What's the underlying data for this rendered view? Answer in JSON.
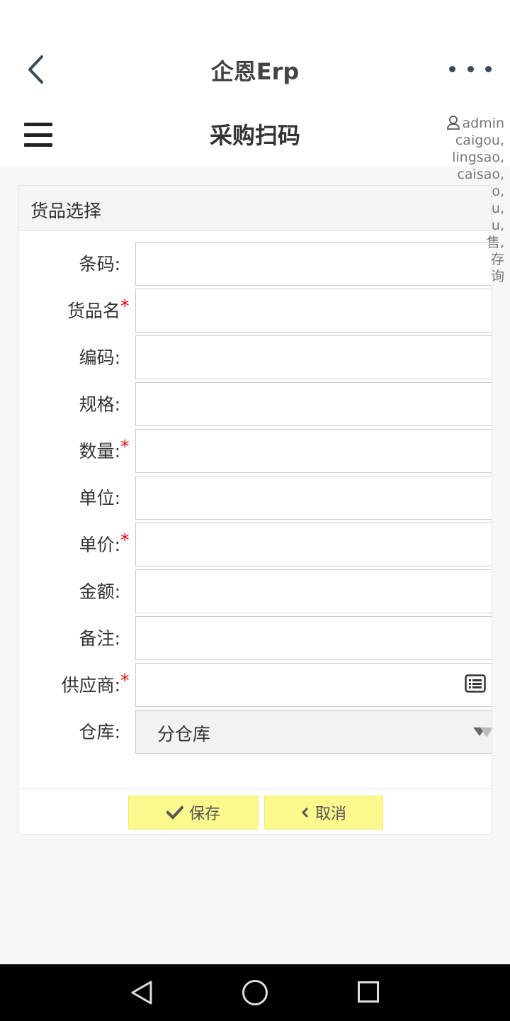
{
  "app": {
    "title": "企恩Erp"
  },
  "page": {
    "title": "采购扫码"
  },
  "user": {
    "lines": [
      "admin",
      "caigou,",
      "lingsao,",
      "caisao,",
      "o,",
      "u,",
      "u,",
      "售,",
      "存",
      "询"
    ]
  },
  "panel": {
    "heading": "货品选择"
  },
  "form": {
    "fields": [
      {
        "label": "条码:",
        "required": false,
        "value": ""
      },
      {
        "label": "货品名",
        "required": true,
        "value": ""
      },
      {
        "label": "编码:",
        "required": false,
        "value": ""
      },
      {
        "label": "规格:",
        "required": false,
        "value": ""
      },
      {
        "label": "数量:",
        "required": true,
        "value": ""
      },
      {
        "label": "单位:",
        "required": false,
        "value": ""
      },
      {
        "label": "单价:",
        "required": true,
        "value": ""
      },
      {
        "label": "金额:",
        "required": false,
        "value": ""
      },
      {
        "label": "备注:",
        "required": false,
        "value": ""
      },
      {
        "label": "供应商:",
        "required": true,
        "value": ""
      }
    ],
    "required_mark": "*",
    "warehouse": {
      "label": "仓库:",
      "selected": "分仓库"
    }
  },
  "buttons": {
    "save": "保存",
    "cancel": "取消"
  },
  "colors": {
    "button_bg": "#fbf88d",
    "required": "#ee0000",
    "header_bg": "#ffffff",
    "page_bg": "#f7f7f7"
  }
}
